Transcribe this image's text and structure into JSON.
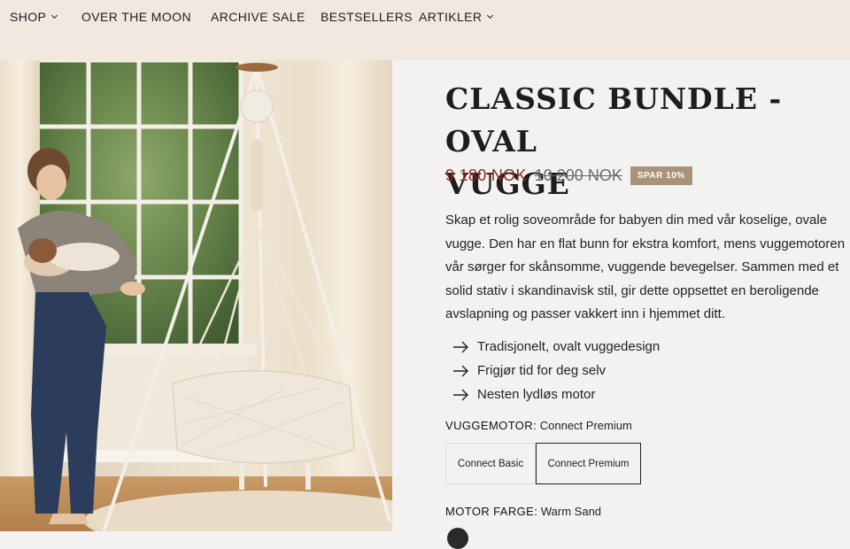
{
  "nav": {
    "items": [
      {
        "label": "SHOP",
        "dropdown": true
      },
      {
        "label": "OVER THE MOON",
        "dropdown": false
      },
      {
        "label": "ARCHIVE SALE",
        "dropdown": false
      },
      {
        "label": "BESTSELLERS",
        "dropdown": false
      },
      {
        "label": "ARTIKLER",
        "dropdown": true
      }
    ]
  },
  "product": {
    "title_line1": "CLASSIC BUNDLE - OVAL",
    "title_line2": "VUGGE",
    "price": "9 180 NOK",
    "old_price": "10 200 NOK",
    "badge": "SPAR 10%",
    "description": "Skap et rolig soveområde for babyen din med vår koselige, ovale vugge. Den har en flat bunn for ekstra komfort, mens vuggemotoren vår sørger for skånsomme, vuggende bevegelser. Sammen med et solid stativ i skandinavisk stil, gir dette oppsettet en beroligende avslapning og passer vakkert inn i hjemmet ditt.",
    "features": [
      "Tradisjonelt, ovalt vuggedesign",
      "Frigjør tid for deg selv",
      "Nesten lydløs motor"
    ]
  },
  "options": {
    "motor_label": "VUGGEMOTOR:",
    "motor_value": "Connect Premium",
    "motor_choices": [
      "Connect Basic",
      "Connect Premium"
    ],
    "color_label": "MOTOR FARGE:",
    "color_value": "Warm Sand"
  },
  "colors": {
    "nav_bg": "#f1e9e0",
    "price": "#8e2a20",
    "badge_bg": "#a8937a",
    "panel_bg": "#f3f2f0"
  }
}
